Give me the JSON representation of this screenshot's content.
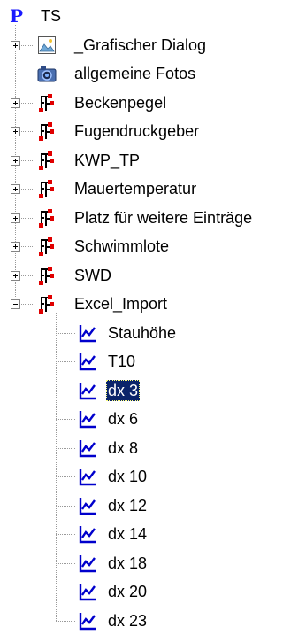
{
  "root": {
    "icon": "project-p-icon",
    "label": "TS"
  },
  "folders": [
    {
      "label": "_Grafischer Dialog",
      "icon": "picture-icon",
      "expander": "plus"
    },
    {
      "label": "allgemeine Fotos",
      "icon": "camera-icon",
      "expander": "none"
    },
    {
      "label": "Beckenpegel",
      "icon": "sensor-tree-icon",
      "expander": "plus"
    },
    {
      "label": "Fugendruckgeber",
      "icon": "sensor-tree-icon",
      "expander": "plus"
    },
    {
      "label": "KWP_TP",
      "icon": "sensor-tree-icon",
      "expander": "plus"
    },
    {
      "label": "Mauertemperatur",
      "icon": "sensor-tree-icon",
      "expander": "plus"
    },
    {
      "label": "Platz für weitere Einträge",
      "icon": "sensor-tree-icon",
      "expander": "plus"
    },
    {
      "label": "Schwimmlote",
      "icon": "sensor-tree-icon",
      "expander": "plus"
    },
    {
      "label": "SWD",
      "icon": "sensor-tree-icon",
      "expander": "plus"
    },
    {
      "label": "Excel_Import",
      "icon": "sensor-tree-icon",
      "expander": "minus"
    }
  ],
  "excel_children": [
    {
      "label": "Stauhöhe",
      "icon": "line-chart-icon",
      "selected": false
    },
    {
      "label": "T10",
      "icon": "line-chart-icon",
      "selected": false
    },
    {
      "label": "dx 3",
      "icon": "line-chart-icon",
      "selected": true
    },
    {
      "label": "dx 6",
      "icon": "line-chart-icon",
      "selected": false
    },
    {
      "label": "dx 8",
      "icon": "line-chart-icon",
      "selected": false
    },
    {
      "label": "dx 10",
      "icon": "line-chart-icon",
      "selected": false
    },
    {
      "label": "dx 12",
      "icon": "line-chart-icon",
      "selected": false
    },
    {
      "label": "dx 14",
      "icon": "line-chart-icon",
      "selected": false
    },
    {
      "label": "dx 18",
      "icon": "line-chart-icon",
      "selected": false
    },
    {
      "label": "dx 20",
      "icon": "line-chart-icon",
      "selected": false
    },
    {
      "label": "dx 23",
      "icon": "line-chart-icon",
      "selected": false
    }
  ],
  "colors": {
    "selection": "#0a246a",
    "project_icon": "#1a1aff",
    "chart_icon": "#0000cc",
    "sensor_node": "#e00000"
  }
}
